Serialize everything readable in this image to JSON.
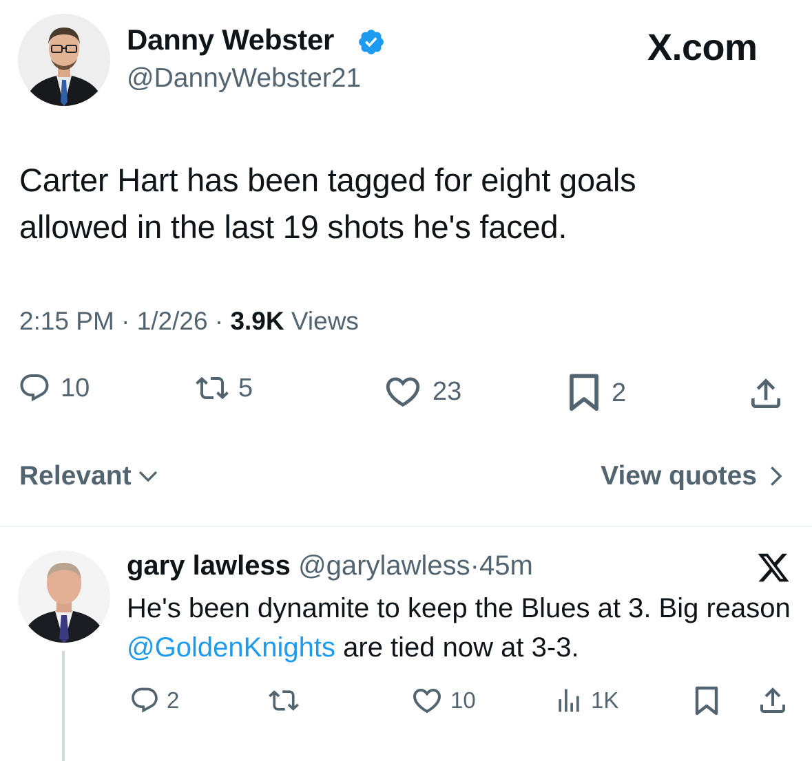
{
  "tweet": {
    "author_name": "Danny Webster",
    "author_handle": "@DannyWebster21",
    "brand": "X.com",
    "text_line1": "Carter Hart has been tagged for eight goals",
    "text_line2": "allowed in the last 19 shots he's faced.",
    "time": "2:15 PM",
    "date": "1/2/26",
    "sep": "·",
    "views_count": "3.9K",
    "views_label": "Views",
    "actions": {
      "replies": "10",
      "reposts": "5",
      "likes": "23",
      "bookmarks": "2"
    }
  },
  "filters": {
    "sort_label": "Relevant",
    "view_quotes_label": "View quotes"
  },
  "reply": {
    "author_name": "gary lawless",
    "author_handle": "@garylawless",
    "sep": "·",
    "age": "45m",
    "text_part1": "He's been dynamite to keep the Blues at 3. Big reason ",
    "mention": "@GoldenKnights",
    "text_part2": " are tied now at 3-3.",
    "actions": {
      "replies": "2",
      "likes": "10",
      "views": "1K"
    }
  },
  "colors": {
    "text": "#0f1419",
    "muted": "#536471",
    "accent": "#1d9bf0",
    "divider": "#eff3f4"
  },
  "icons": [
    "verified-badge-icon",
    "reply-icon",
    "repost-icon",
    "like-icon",
    "bookmark-icon",
    "share-icon",
    "chevron-down-icon",
    "chevron-right-icon",
    "x-logo-icon",
    "views-icon"
  ]
}
